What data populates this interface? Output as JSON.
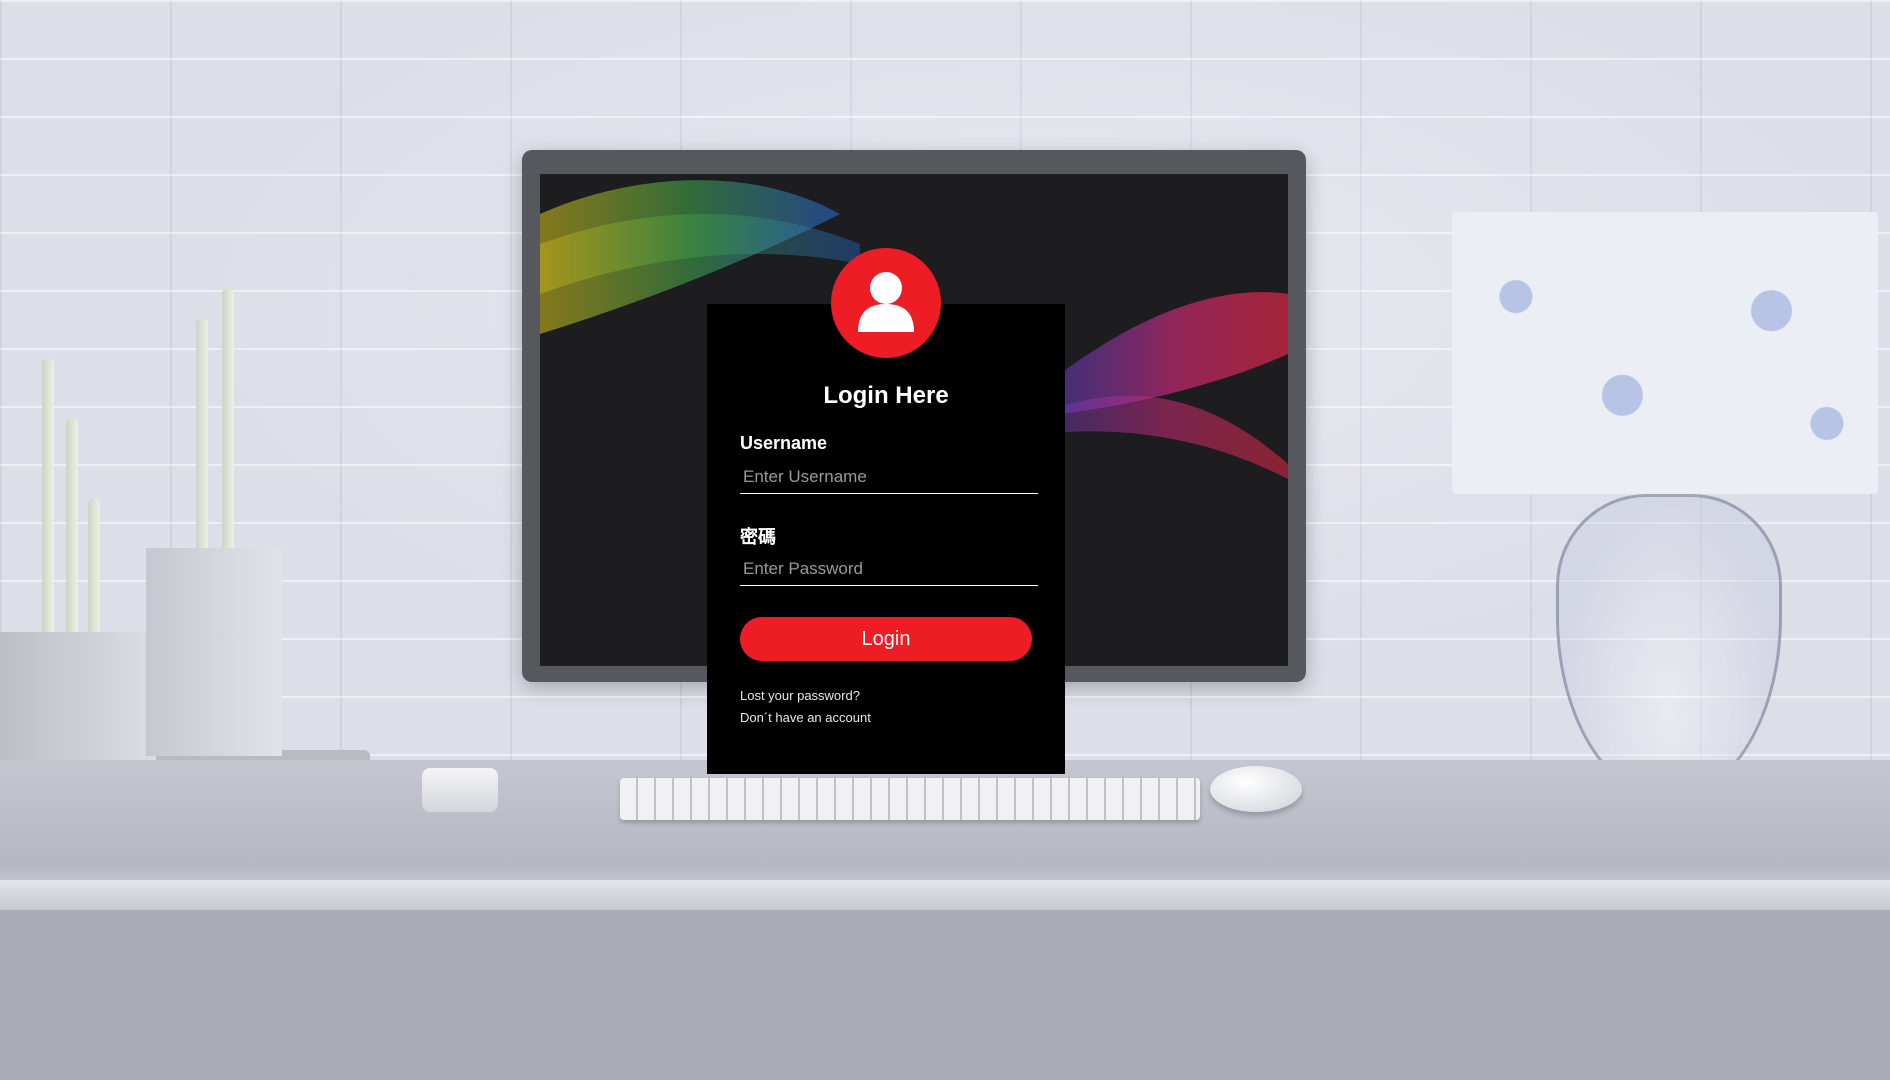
{
  "login": {
    "title": "Login Here",
    "username_label": "Username",
    "username_placeholder": "Enter Username",
    "password_label": "密碼",
    "password_placeholder": "Enter Password",
    "login_button": "Login",
    "lost_password_link": "Lost your password?",
    "no_account_link": "Don´t have an account"
  },
  "icons": {
    "avatar": "user-icon"
  },
  "colors": {
    "accent": "#ee1c24",
    "card_background": "#000000",
    "text": "#ffffff"
  }
}
